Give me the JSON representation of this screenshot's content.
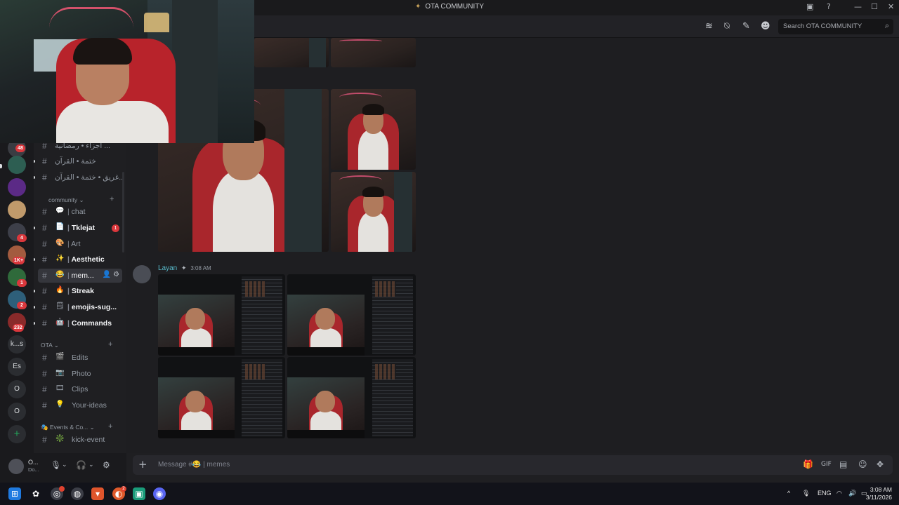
{
  "window": {
    "title": "OTA COMMUNITY",
    "controls": [
      "—",
      "☐",
      "✕"
    ]
  },
  "header": {
    "search_placeholder": "Search OTA COMMUNITY"
  },
  "rail": {
    "servers": [
      {
        "label": "",
        "badge": "48"
      },
      {
        "label": "",
        "badge": ""
      },
      {
        "label": "",
        "badge": ""
      },
      {
        "label": "",
        "badge": ""
      },
      {
        "label": "",
        "badge": "4"
      },
      {
        "label": "",
        "badge": "1K+"
      },
      {
        "label": "",
        "badge": "1"
      },
      {
        "label": "",
        "badge": "2"
      },
      {
        "label": "",
        "badge": "232"
      },
      {
        "label": "k...s",
        "badge": ""
      },
      {
        "label": "Es",
        "badge": ""
      },
      {
        "label": "O",
        "badge": ""
      },
      {
        "label": "O",
        "badge": ""
      },
      {
        "label": "+",
        "badge": ""
      }
    ]
  },
  "channels": {
    "top": [
      {
        "emoji": "",
        "name": "أجزاء • رمضانية ..."
      },
      {
        "emoji": "🕌",
        "name": "ختمة • القرآن"
      },
      {
        "emoji": "",
        "name": "غريق • ختمة • القرآن..."
      }
    ],
    "community_label": "community",
    "community": [
      {
        "emoji": "💬",
        "name": "chat",
        "unread": false,
        "badge": ""
      },
      {
        "emoji": "📄",
        "name": "Tklejat",
        "unread": true,
        "badge": "1"
      },
      {
        "emoji": "🎨",
        "name": "Art",
        "unread": false,
        "badge": ""
      },
      {
        "emoji": "✨",
        "name": "Aesthetic",
        "unread": true,
        "badge": ""
      },
      {
        "emoji": "😂",
        "name": "mem...",
        "unread": false,
        "badge": "",
        "active": true
      },
      {
        "emoji": "🔥",
        "name": "Streak",
        "unread": true,
        "badge": ""
      },
      {
        "emoji": "🗒",
        "name": "emojis-sug...",
        "unread": true,
        "badge": ""
      },
      {
        "emoji": "🤖",
        "name": "Commands",
        "unread": true,
        "badge": ""
      }
    ],
    "ota_label": "OTA",
    "ota": [
      {
        "emoji": "🎬",
        "name": "Edits"
      },
      {
        "emoji": "📷",
        "name": "Photo"
      },
      {
        "emoji": "🎞",
        "name": "Clips"
      },
      {
        "emoji": "💡",
        "name": "Your-ideas"
      }
    ],
    "events_label": "Events & Co...",
    "events": [
      {
        "emoji": "❇️",
        "name": "kick-event"
      }
    ]
  },
  "user": {
    "name": "O...",
    "status": "Do..."
  },
  "message": {
    "author": "Layan",
    "boost": "✦",
    "time": "3:08 AM"
  },
  "composer": {
    "placeholder": "Message #😂 | memes"
  },
  "taskbar": {
    "badge_brave": "",
    "badge_red": "2",
    "lang": "ENG",
    "time": "3:08 AM",
    "date": "3/11/2026"
  }
}
